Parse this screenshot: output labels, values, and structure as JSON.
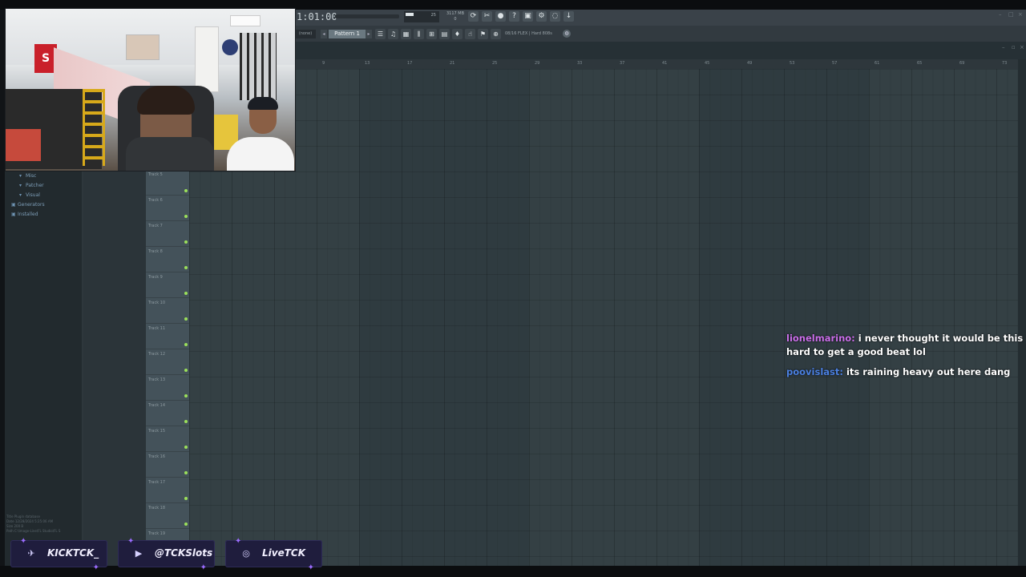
{
  "toolbar": {
    "time": "1:01:00",
    "meter_value": "25",
    "memory_top": "3117 MB",
    "memory_bottom": "0",
    "icons": [
      "reload-icon",
      "mixer-cut-icon",
      "mic-icon",
      "help-icon",
      "save-icon",
      "plugin-icon",
      "chat-bubble-icon",
      "download-icon"
    ]
  },
  "toolbar2": {
    "mode_dropdown": "(none)",
    "pattern_label": "Pattern 1",
    "flex_label": "08/16 FLEX | Hard 808s"
  },
  "ruler": {
    "bars": [
      "9",
      "13",
      "17",
      "21",
      "25",
      "29",
      "33",
      "37",
      "41",
      "45",
      "49",
      "53",
      "57",
      "61",
      "65",
      "69",
      "73",
      "77"
    ]
  },
  "browser": {
    "items": [
      {
        "label": "Misc",
        "level": 1
      },
      {
        "label": "Patcher",
        "level": 1
      },
      {
        "label": "Visual",
        "level": 1
      },
      {
        "label": "Generators",
        "level": 0
      },
      {
        "label": "Installed",
        "level": 0
      }
    ],
    "meta": {
      "title": "Title   Plugin database",
      "date": "Date    12/28/2024 5:25:06 AM",
      "size": "Size    200 B",
      "path": "Path    C:\\Image-Line\\FL Studio\\FL S"
    }
  },
  "tracks": [
    "Track 5",
    "Track 6",
    "Track 7",
    "Track 8",
    "Track 9",
    "Track 10",
    "Track 11",
    "Track 12",
    "Track 13",
    "Track 14",
    "Track 15",
    "Track 16",
    "Track 17",
    "Track 18",
    "Track 19"
  ],
  "chat": {
    "messages": [
      {
        "user": "lionelmarino:",
        "text": "i never thought it would be this hard to get a good beat lol"
      },
      {
        "user": "poovislast:",
        "text": "its raining heavy out here dang"
      }
    ]
  },
  "socials": [
    {
      "icon": "twitter-icon",
      "label": "KICKTCK_"
    },
    {
      "icon": "youtube-icon",
      "label": "@TCKSlots"
    },
    {
      "icon": "instagram-icon",
      "label": "LiveTCK"
    }
  ],
  "colors": {
    "chat_user1": "#c96ee8",
    "chat_user2": "#4a7fe0",
    "social_bg": "#1f1d3d",
    "track_led": "#9be05a",
    "playlist_bg": "#2f3b40"
  }
}
